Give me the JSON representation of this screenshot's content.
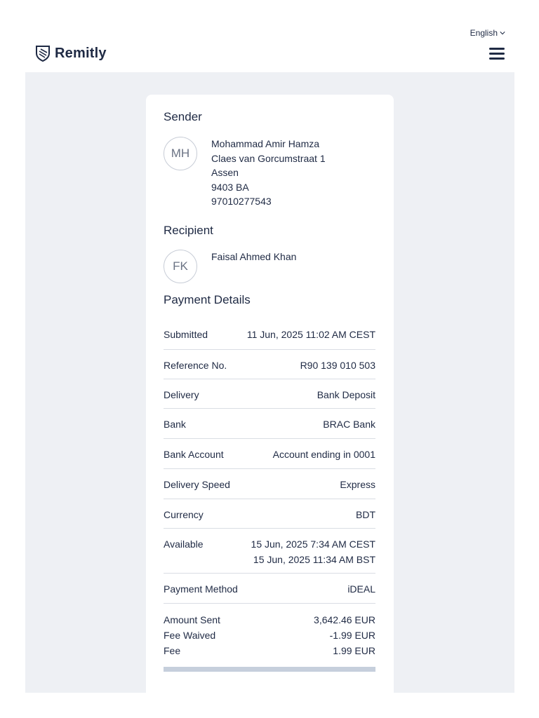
{
  "header": {
    "language": "English",
    "brand": "Remitly"
  },
  "sender": {
    "title": "Sender",
    "initials": "MH",
    "lines": [
      "Mohammad Amir Hamza",
      "Claes van Gorcumstraat 1",
      "Assen",
      "9403 BA",
      "97010277543"
    ]
  },
  "recipient": {
    "title": "Recipient",
    "initials": "FK",
    "name": "Faisal Ahmed Khan"
  },
  "payment": {
    "title": "Payment Details",
    "rows": [
      {
        "label": "Submitted",
        "value": "11 Jun, 2025 11:02 AM CEST"
      },
      {
        "label": "Reference No.",
        "value": "R90 139 010 503"
      },
      {
        "label": "Delivery",
        "value": "Bank Deposit"
      },
      {
        "label": "Bank",
        "value": "BRAC Bank"
      },
      {
        "label": "Bank Account",
        "value": "Account ending in 0001"
      },
      {
        "label": "Delivery Speed",
        "value": "Express"
      },
      {
        "label": "Currency",
        "value": "BDT"
      },
      {
        "label": "Available",
        "value": "15 Jun, 2025 7:34 AM CEST",
        "value2": "15 Jun, 2025 11:34 AM BST"
      },
      {
        "label": "Payment Method",
        "value": "iDEAL"
      }
    ],
    "amounts": [
      {
        "label": "Amount Sent",
        "value": "3,642.46 EUR"
      },
      {
        "label": "Fee Waived",
        "value": "-1.99 EUR"
      },
      {
        "label": "Fee",
        "value": "1.99 EUR"
      }
    ]
  }
}
